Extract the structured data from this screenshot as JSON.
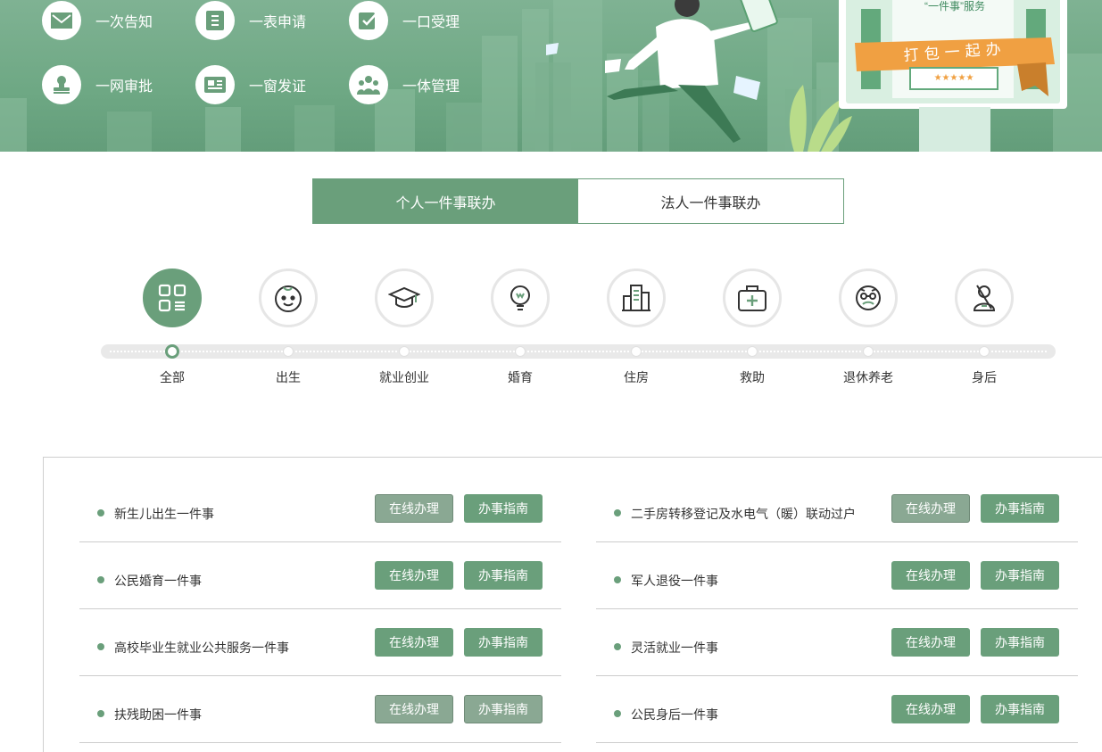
{
  "banner": {
    "features": [
      {
        "label": "一次告知",
        "icon": "mail-icon"
      },
      {
        "label": "一表申请",
        "icon": "form-icon"
      },
      {
        "label": "一口受理",
        "icon": "edit-icon"
      },
      {
        "label": "一网审批",
        "icon": "stamp-icon"
      },
      {
        "label": "一窗发证",
        "icon": "id-card-icon"
      },
      {
        "label": "一体管理",
        "icon": "people-icon"
      }
    ],
    "board_subtitle": "“一件事”服务",
    "ribbon_text": "打包一起办",
    "stars": "★★★★★"
  },
  "tabs": [
    {
      "label": "个人一件事联办",
      "active": true
    },
    {
      "label": "法人一件事联办",
      "active": false
    }
  ],
  "categories": [
    {
      "label": "全部",
      "icon": "grid-icon",
      "active": true
    },
    {
      "label": "出生",
      "icon": "baby-face-icon",
      "active": false
    },
    {
      "label": "就业创业",
      "icon": "graduation-cap-icon",
      "active": false
    },
    {
      "label": "婚育",
      "icon": "lightbulb-icon",
      "active": false
    },
    {
      "label": "住房",
      "icon": "building-icon",
      "active": false
    },
    {
      "label": "救助",
      "icon": "medical-kit-icon",
      "active": false
    },
    {
      "label": "退休养老",
      "icon": "elder-face-icon",
      "active": false
    },
    {
      "label": "身后",
      "icon": "memorial-icon",
      "active": false
    }
  ],
  "buttons": {
    "online": "在线办理",
    "guide": "办事指南"
  },
  "items_left": [
    {
      "name": "新生儿出生一件事",
      "online_state": "gray",
      "guide_state": "green"
    },
    {
      "name": "公民婚育一件事",
      "online_state": "green",
      "guide_state": "green"
    },
    {
      "name": "高校毕业生就业公共服务一件事",
      "online_state": "green",
      "guide_state": "green"
    },
    {
      "name": "扶残助困一件事",
      "online_state": "gray",
      "guide_state": "gray"
    }
  ],
  "items_right": [
    {
      "name": "二手房转移登记及水电气（暖）联动过户",
      "online_state": "gray",
      "guide_state": "green"
    },
    {
      "name": "军人退役一件事",
      "online_state": "green",
      "guide_state": "green"
    },
    {
      "name": "灵活就业一件事",
      "online_state": "green",
      "guide_state": "green"
    },
    {
      "name": "公民身后一件事",
      "online_state": "green",
      "guide_state": "green"
    }
  ],
  "colors": {
    "accent": "#6a9f7b",
    "disabled": "#8aa893",
    "banner": "#6ea884"
  }
}
